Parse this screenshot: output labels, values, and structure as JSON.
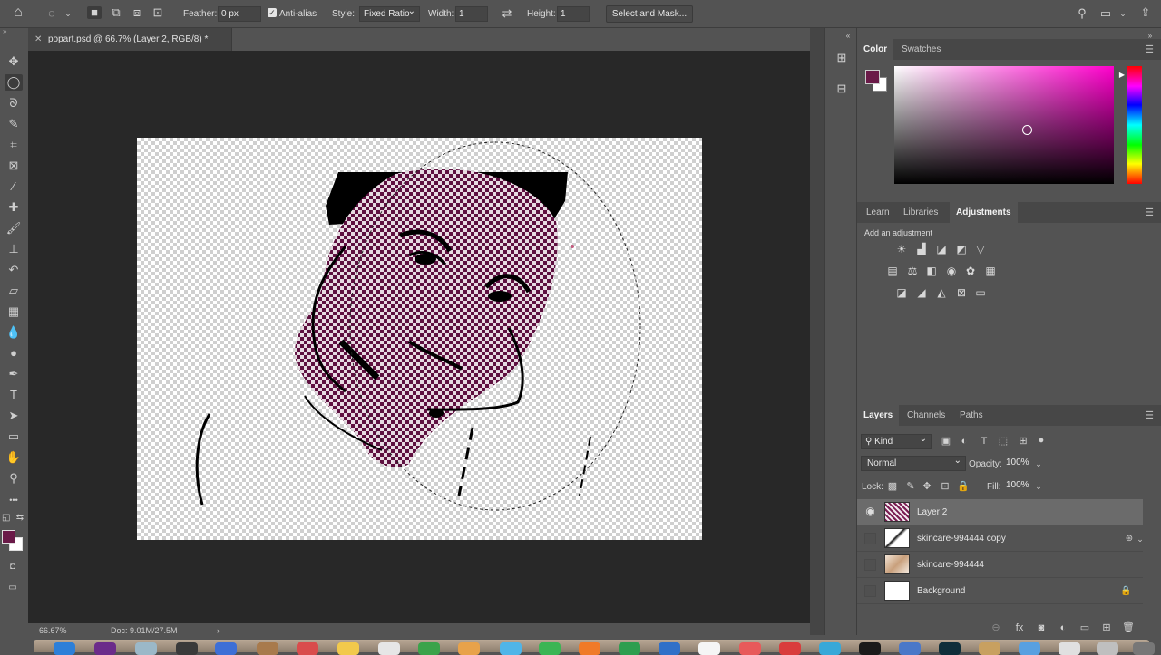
{
  "options_bar": {
    "feather_label": "Feather:",
    "feather_value": "0 px",
    "antialias_label": "Anti-alias",
    "antialias_checked": true,
    "style_label": "Style:",
    "style_value": "Fixed Ratio",
    "width_label": "Width:",
    "width_value": "1",
    "height_label": "Height:",
    "height_value": "1",
    "select_mask_label": "Select and Mask..."
  },
  "document": {
    "tab_title": "popart.psd @ 66.7% (Layer 2, RGB/8) *"
  },
  "tools": [
    {
      "name": "move-tool",
      "glyph": "✥"
    },
    {
      "name": "elliptical-marquee-tool",
      "glyph": "◯",
      "active": true
    },
    {
      "name": "lasso-tool",
      "glyph": "ᘐ"
    },
    {
      "name": "quick-selection-tool",
      "glyph": "✎"
    },
    {
      "name": "crop-tool",
      "glyph": "⌗"
    },
    {
      "name": "frame-tool",
      "glyph": "⊠"
    },
    {
      "name": "eyedropper-tool",
      "glyph": "⁄"
    },
    {
      "name": "healing-brush-tool",
      "glyph": "✚"
    },
    {
      "name": "brush-tool",
      "glyph": "🖌"
    },
    {
      "name": "clone-stamp-tool",
      "glyph": "⊥"
    },
    {
      "name": "history-brush-tool",
      "glyph": "↶"
    },
    {
      "name": "eraser-tool",
      "glyph": "▱"
    },
    {
      "name": "gradient-tool",
      "glyph": "▦"
    },
    {
      "name": "blur-tool",
      "glyph": "💧"
    },
    {
      "name": "dodge-tool",
      "glyph": "●"
    },
    {
      "name": "pen-tool",
      "glyph": "✒"
    },
    {
      "name": "type-tool",
      "glyph": "T"
    },
    {
      "name": "path-selection-tool",
      "glyph": "➤"
    },
    {
      "name": "rectangle-tool",
      "glyph": "▭"
    },
    {
      "name": "hand-tool",
      "glyph": "✋"
    },
    {
      "name": "zoom-tool",
      "glyph": "⚲"
    },
    {
      "name": "more-tools",
      "glyph": "•••"
    }
  ],
  "status": {
    "zoom": "66.67%",
    "doc_info": "Doc: 9.01M/27.5M"
  },
  "color_panel": {
    "tabs": [
      "Color",
      "Swatches"
    ],
    "active_tab": "Color",
    "foreground_color": "#6a1a48",
    "background_color": "#ffffff",
    "hue_color": "#ff00cc"
  },
  "adjustments_panel": {
    "tabs": [
      "Learn",
      "Libraries",
      "Adjustments"
    ],
    "active_tab": "Adjustments",
    "hint": "Add an adjustment",
    "rows": [
      [
        "brightness-contrast-icon",
        "levels-icon",
        "curves-icon",
        "exposure-icon",
        "vibrance-icon"
      ],
      [
        "hue-saturation-icon",
        "color-balance-icon",
        "black-white-icon",
        "photo-filter-icon",
        "channel-mixer-icon",
        "color-lookup-icon"
      ],
      [
        "invert-icon",
        "posterize-icon",
        "threshold-icon",
        "selective-color-icon",
        "gradient-map-icon"
      ]
    ]
  },
  "layers_panel": {
    "tabs": [
      "Layers",
      "Channels",
      "Paths"
    ],
    "active_tab": "Layers",
    "kind_label": "Kind",
    "blend_mode": "Normal",
    "opacity_label": "Opacity:",
    "opacity_value": "100%",
    "lock_label": "Lock:",
    "fill_label": "Fill:",
    "fill_value": "100%",
    "layers": [
      {
        "name": "Layer 2",
        "visible": true,
        "selected": true
      },
      {
        "name": "skincare-994444 copy",
        "visible": false,
        "selected": false
      },
      {
        "name": "skincare-994444",
        "visible": false,
        "selected": false
      },
      {
        "name": "Background",
        "visible": false,
        "selected": false,
        "locked": true
      }
    ]
  },
  "accent_colors": {
    "panel_bg": "#535353",
    "workspace_bg": "#282828",
    "magenta": "#7a1d52"
  }
}
